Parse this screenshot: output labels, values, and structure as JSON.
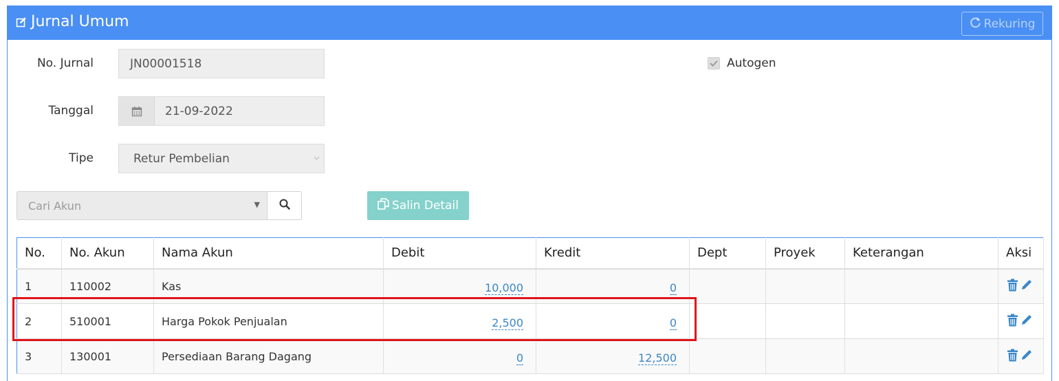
{
  "header": {
    "title": "Jurnal Umum",
    "rekuring_label": "Rekuring"
  },
  "form": {
    "no_jurnal_label": "No. Jurnal",
    "no_jurnal_value": "JN00001518",
    "tanggal_label": "Tanggal",
    "tanggal_value": "21-09-2022",
    "tipe_label": "Tipe",
    "tipe_value": "Retur Pembelian",
    "autogen_label": "Autogen",
    "autogen_checked": true
  },
  "toolbar": {
    "cari_akun_placeholder": "Cari Akun",
    "salin_detail_label": "Salin Detail"
  },
  "table": {
    "headers": [
      "No.",
      "No. Akun",
      "Nama Akun",
      "Debit",
      "Kredit",
      "Dept",
      "Proyek",
      "Keterangan",
      "Aksi"
    ],
    "rows": [
      {
        "no": "1",
        "no_akun": "110002",
        "nama_akun": "Kas",
        "debit": "10,000",
        "kredit": "0",
        "dept": "",
        "proyek": "",
        "keterangan": ""
      },
      {
        "no": "2",
        "no_akun": "510001",
        "nama_akun": "Harga Pokok Penjualan",
        "debit": "2,500",
        "kredit": "0",
        "dept": "",
        "proyek": "",
        "keterangan": ""
      },
      {
        "no": "3",
        "no_akun": "130001",
        "nama_akun": "Persediaan Barang Dagang",
        "debit": "0",
        "kredit": "12,500",
        "dept": "",
        "proyek": "",
        "keterangan": ""
      }
    ]
  },
  "icons": {
    "title": "edit-icon",
    "rekuring": "refresh-icon",
    "tanggal": "calendar-icon",
    "search": "search-icon",
    "salin": "copy-icon",
    "delete": "trash-icon",
    "edit": "pencil-icon"
  },
  "colors": {
    "header_bg": "#4a8ff3",
    "salin_button_bg": "#84d2cb",
    "amount_link": "#3a87c8",
    "highlight_border": "#e0131a"
  }
}
